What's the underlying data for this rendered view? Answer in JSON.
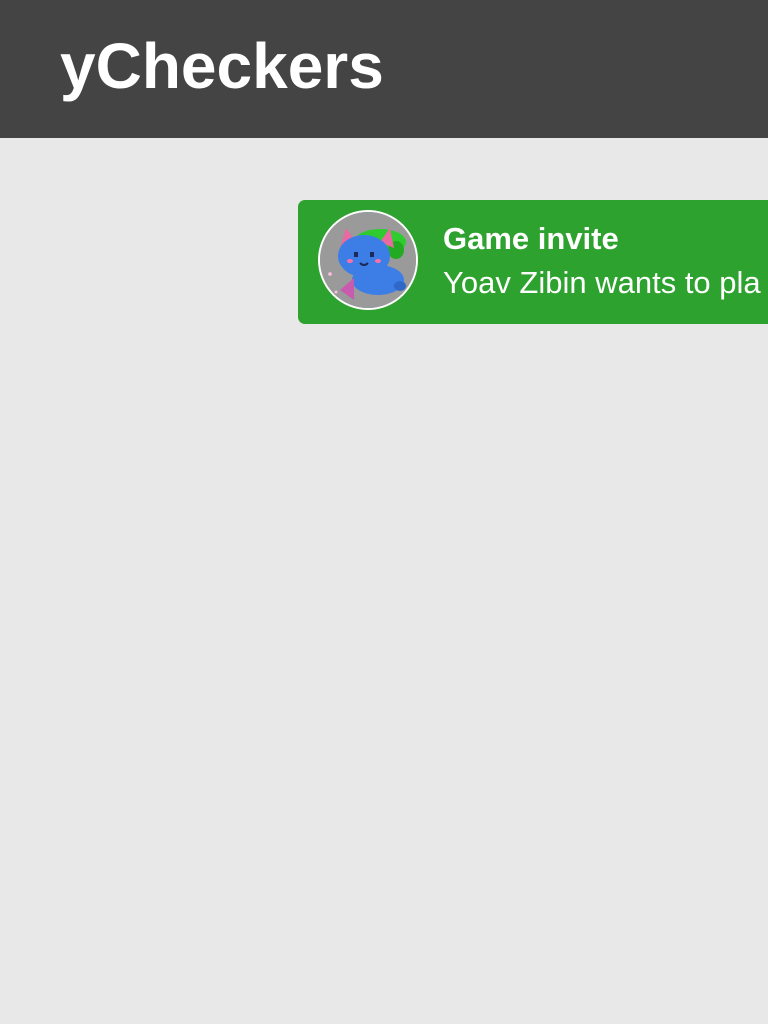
{
  "header": {
    "title": "yCheckers",
    "background": "#444444"
  },
  "notification": {
    "title": "Game invite",
    "message": "Yoav Zibin wants to pla",
    "background": "#2ea22e",
    "avatar_icon": "blue-creature-avatar-icon"
  },
  "colors": {
    "page_background": "#e8e8e8",
    "text": "#ffffff"
  }
}
